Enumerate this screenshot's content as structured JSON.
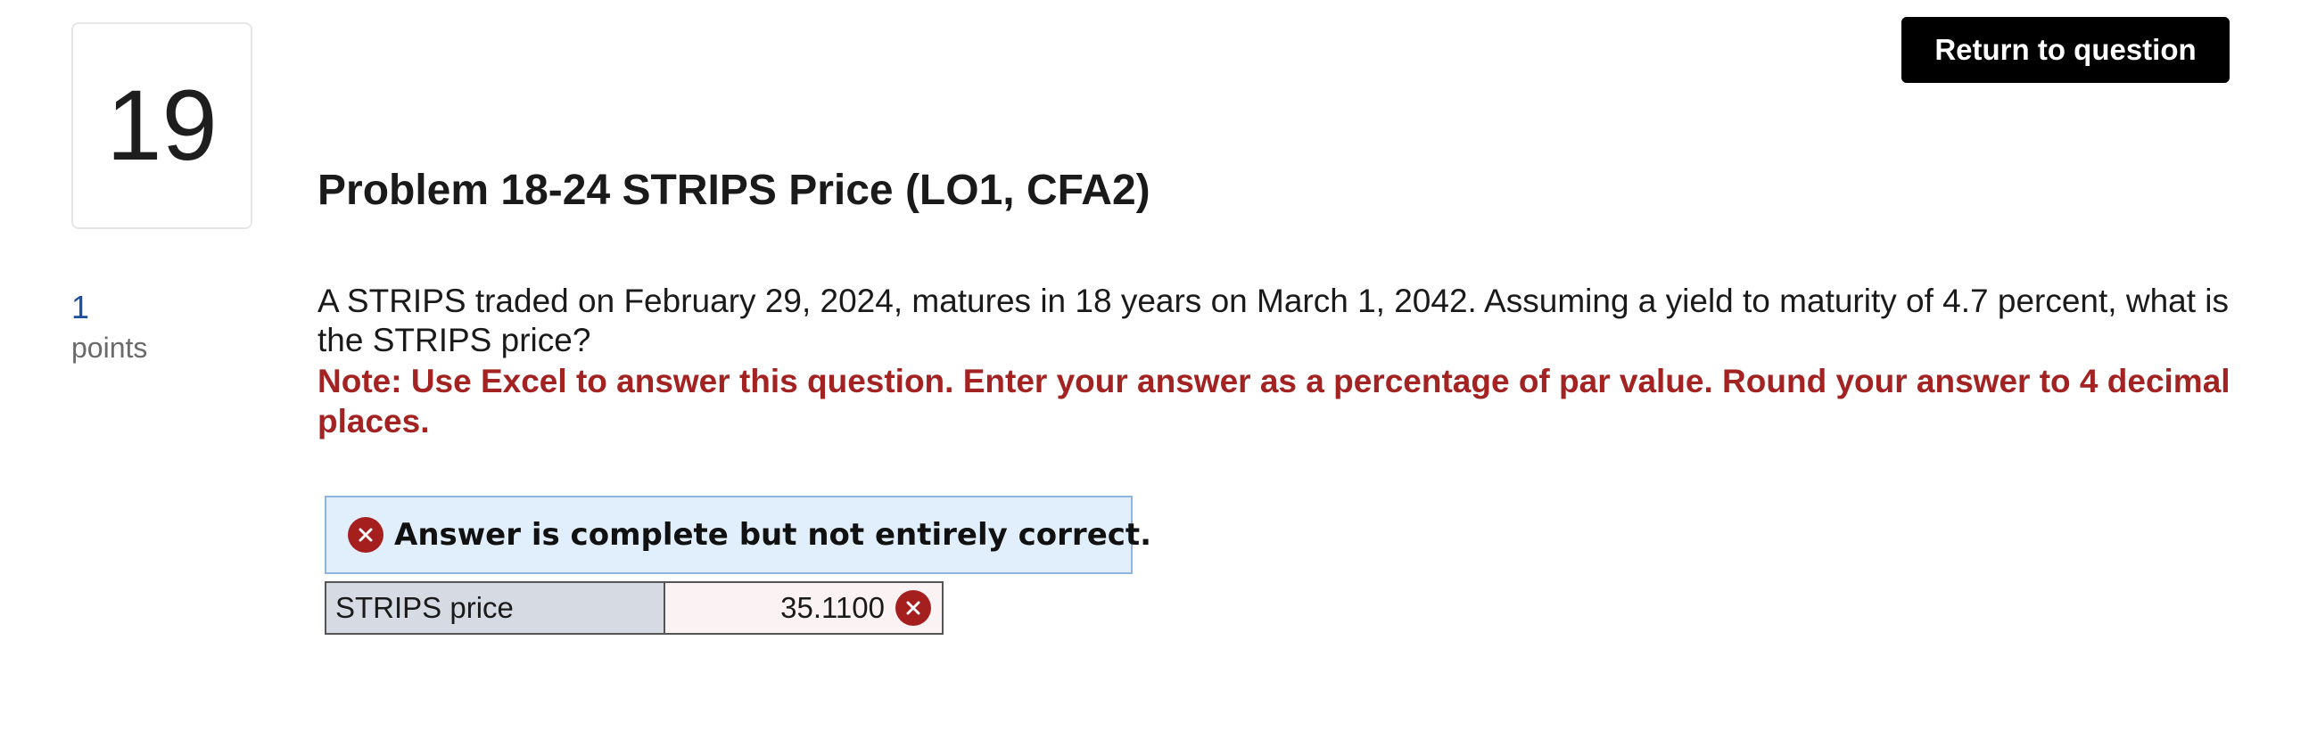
{
  "question": {
    "number": "19",
    "points_value": "1",
    "points_label": "points",
    "title": "Problem 18-24 STRIPS Price (LO1, CFA2)",
    "text": "A STRIPS traded on February 29, 2024, matures in 18 years on March 1, 2042. Assuming a yield to maturity of 4.7 percent, what is the STRIPS price?",
    "note": "Note: Use Excel to answer this question. Enter your answer as a percentage of par value. Round your answer to 4 decimal places."
  },
  "header": {
    "return_label": "Return to question"
  },
  "result": {
    "banner": "Answer is complete but not entirely correct.",
    "icon": "x-circle-icon",
    "color": "#a61f1f",
    "banner_bg": "#e1eefb"
  },
  "answer_table": {
    "rows": [
      {
        "label": "STRIPS price",
        "value": "35.1100",
        "status": "incorrect"
      }
    ]
  }
}
